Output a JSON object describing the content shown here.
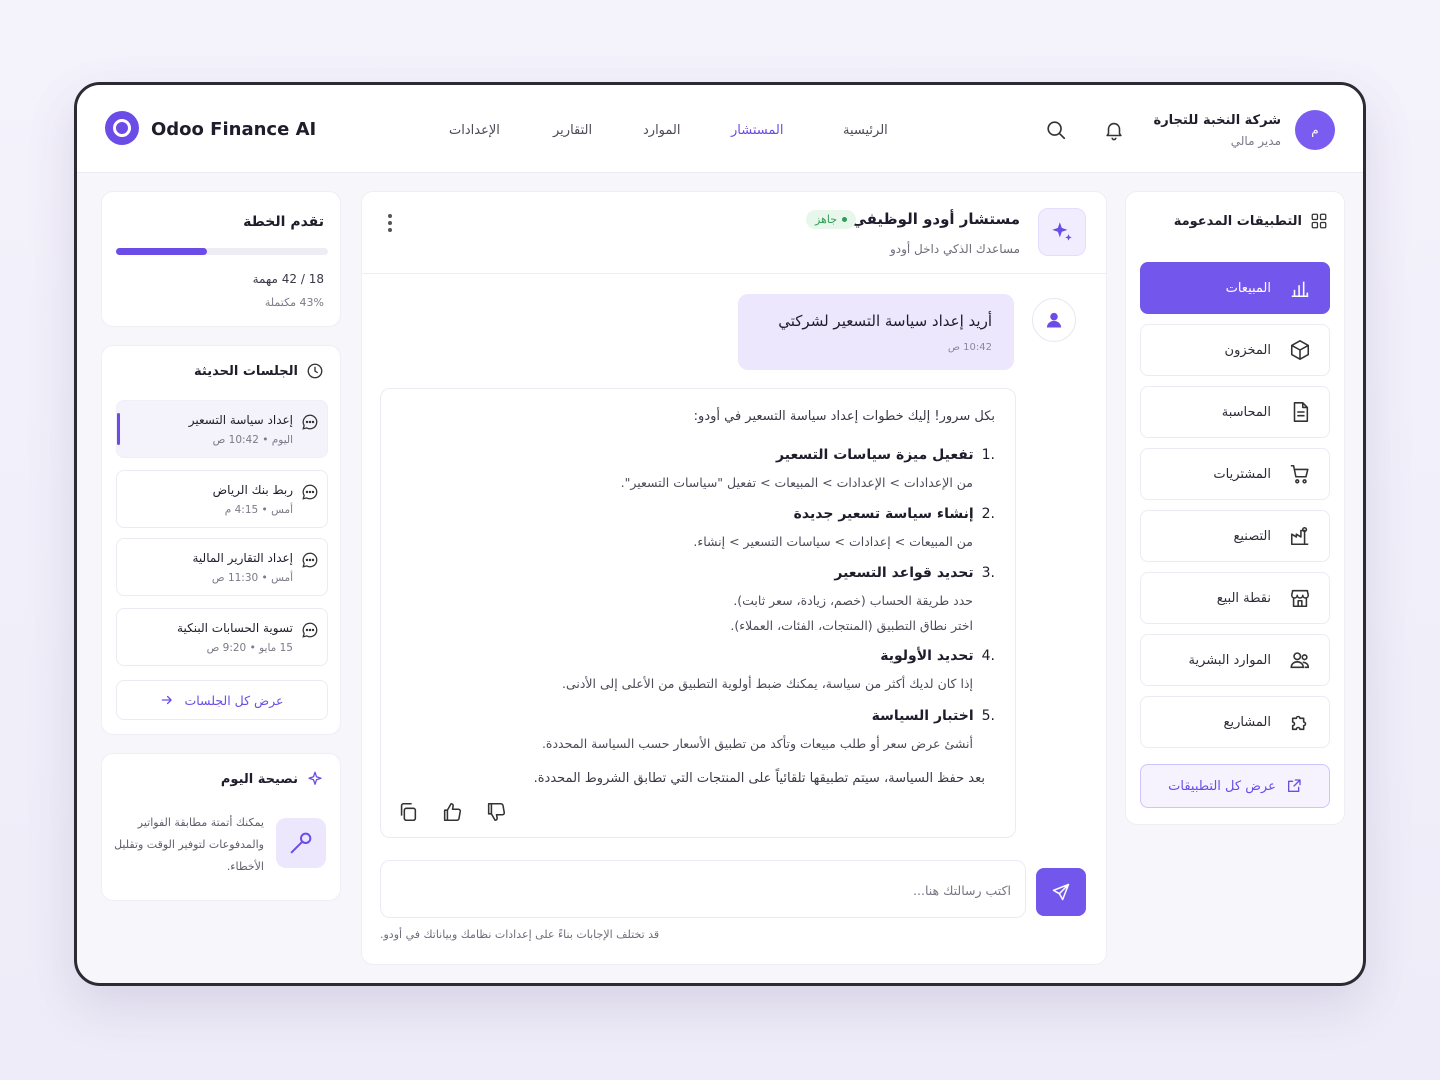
{
  "brand": {
    "name": "Odoo Finance AI"
  },
  "nav": {
    "items": [
      {
        "label": "الرئيسية",
        "active": false
      },
      {
        "label": "المستشار",
        "active": true
      },
      {
        "label": "الموارد",
        "active": false
      },
      {
        "label": "التقارير",
        "active": false
      },
      {
        "label": "الإعدادات",
        "active": false
      }
    ]
  },
  "company": {
    "name": "شركة النخبة للتجارة",
    "role": "مدير مالي",
    "avatar_initial": "م"
  },
  "apps": {
    "title": "التطبيقات المدعومة",
    "items": [
      {
        "label": "المبيعات",
        "icon": "bar-chart-icon",
        "active": true
      },
      {
        "label": "المخزون",
        "icon": "box-icon",
        "active": false
      },
      {
        "label": "المحاسبة",
        "icon": "document-icon",
        "active": false
      },
      {
        "label": "المشتريات",
        "icon": "cart-icon",
        "active": false
      },
      {
        "label": "التصنيع",
        "icon": "factory-icon",
        "active": false
      },
      {
        "label": "نقطة البيع",
        "icon": "store-icon",
        "active": false
      },
      {
        "label": "الموارد البشرية",
        "icon": "users-icon",
        "active": false
      },
      {
        "label": "المشاريع",
        "icon": "puzzle-icon",
        "active": false
      }
    ],
    "view_all": "عرض كل التطبيقات"
  },
  "chat": {
    "title": "مستشار أودو الوظيفي",
    "status": "جاهز",
    "subtitle": "مساعدك الذكي داخل أودو",
    "user_message": {
      "text": "أريد إعداد سياسة التسعير لشركتي",
      "time": "10:42 ص"
    },
    "ai": {
      "intro": "بكل سرور! إليك خطوات إعداد سياسة التسعير في أودو:",
      "steps": [
        {
          "num": ".1",
          "title": "تفعيل ميزة سياسات التسعير",
          "lines": [
            "من الإعدادات > الإعدادات > المبيعات > تفعيل \"سياسات التسعير\"."
          ]
        },
        {
          "num": ".2",
          "title": "إنشاء سياسة تسعير جديدة",
          "lines": [
            "من المبيعات > إعدادات > سياسات التسعير > إنشاء."
          ]
        },
        {
          "num": ".3",
          "title": "تحديد قواعد التسعير",
          "lines": [
            "حدد طريقة الحساب (خصم، زيادة، سعر ثابت).",
            "اختر نطاق التطبيق (المنتجات، الفئات، العملاء)."
          ]
        },
        {
          "num": ".4",
          "title": "تحديد الأولوية",
          "lines": [
            "إذا كان لديك أكثر من سياسة، يمكنك ضبط أولوية التطبيق من الأعلى إلى الأدنى."
          ]
        },
        {
          "num": ".5",
          "title": "اختبار السياسة",
          "lines": [
            "أنشئ عرض سعر أو طلب مبيعات وتأكد من تطبيق الأسعار حسب السياسة المحددة."
          ]
        }
      ],
      "outro": "بعد حفظ السياسة، سيتم تطبيقها تلقائياً على المنتجات التي تطابق الشروط المحددة."
    },
    "composer_placeholder": "اكتب رسالتك هنا...",
    "disclaimer": "قد تختلف الإجابات بناءً على إعدادات نظامك وبياناتك في أودو."
  },
  "progress": {
    "title": "تقدم الخطة",
    "tasks": "18 / 42 مهمة",
    "percent_label": "43% مكتملة",
    "value": 0.43
  },
  "recent": {
    "title": "الجلسات الحديثة",
    "sessions": [
      {
        "title": "إعداد سياسة التسعير",
        "time": "اليوم • 10:42 ص",
        "active": true
      },
      {
        "title": "ربط بنك الرياض",
        "time": "أمس • 4:15 م",
        "active": false
      },
      {
        "title": "إعداد التقارير المالية",
        "time": "أمس • 11:30 ص",
        "active": false
      },
      {
        "title": "تسوية الحسابات البنكية",
        "time": "15 مايو • 9:20 ص",
        "active": false
      }
    ],
    "view_all": "عرض كل الجلسات"
  },
  "tip": {
    "title": "نصيحة اليوم",
    "text": "يمكنك أتمتة مطابقة الفواتير والمدفوعات لتوفير الوقت وتقليل الأخطاء."
  },
  "colors": {
    "accent": "#6c4ce6",
    "success": "#2f9e53",
    "frame": "#2c2b33"
  }
}
